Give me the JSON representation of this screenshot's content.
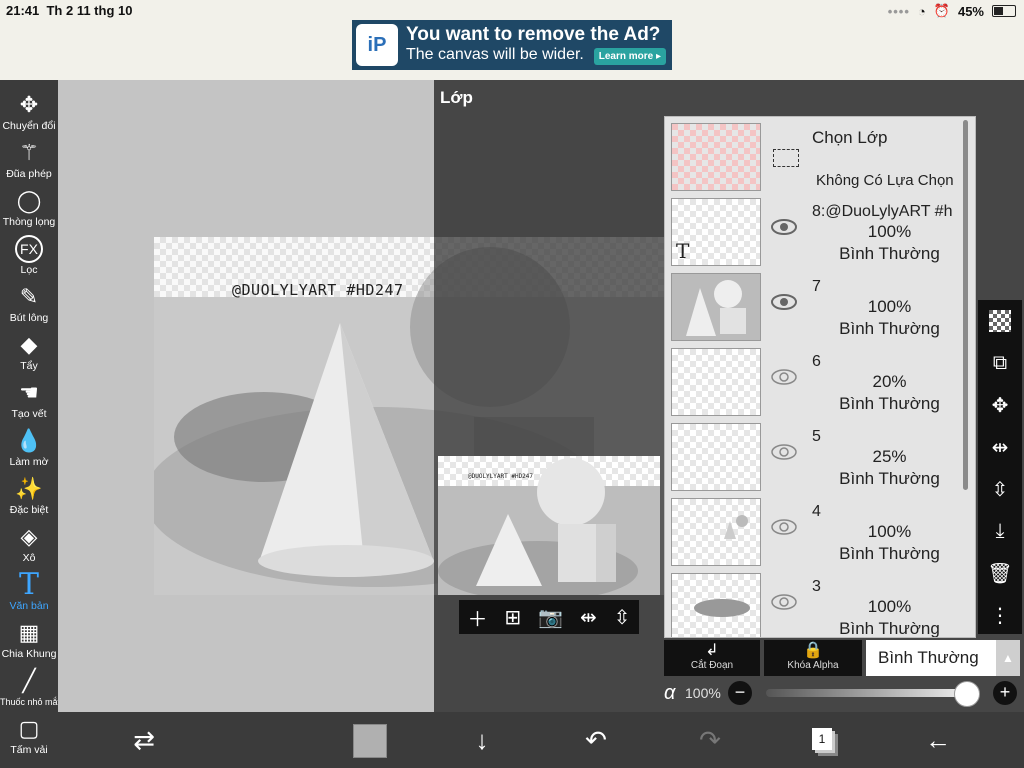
{
  "status_bar": {
    "time": "21:41",
    "date": "Th 2 11 thg 10",
    "battery": "45%"
  },
  "ad": {
    "title": "You want to remove the Ad?",
    "subtitle": "The canvas will be wider.",
    "cta": "Learn more ▸"
  },
  "toolbar": {
    "tools": [
      {
        "label": "Chuyển đổi",
        "icon": "move-icon"
      },
      {
        "label": "Đũa phép",
        "icon": "magic-wand-icon"
      },
      {
        "label": "Thòng lọng",
        "icon": "lasso-icon"
      },
      {
        "label": "Lọc",
        "icon": "fx-icon"
      },
      {
        "label": "Bút lông",
        "icon": "brush-icon"
      },
      {
        "label": "Tẩy",
        "icon": "eraser-icon"
      },
      {
        "label": "Tạo vết",
        "icon": "smudge-icon"
      },
      {
        "label": "Làm mờ",
        "icon": "blur-icon"
      },
      {
        "label": "Đặc biệt",
        "icon": "special-icon"
      },
      {
        "label": "Xô",
        "icon": "bucket-icon"
      },
      {
        "label": "Văn bản",
        "icon": "text-icon"
      },
      {
        "label": "Chia Khung",
        "icon": "frame-divider-icon"
      },
      {
        "label": "Thuốc nhỏ mắt",
        "icon": "eyedropper-icon"
      },
      {
        "label": "Tấm vải",
        "icon": "canvas-icon"
      }
    ],
    "active_tool": "Văn bản"
  },
  "canvas": {
    "watermark": "@DUOLYLYART #HD247",
    "preview_watermark": "@DUOLYLYART #HD247"
  },
  "layer_panel": {
    "title": "Lớp",
    "selection_layer": {
      "name": "Chọn Lớp",
      "status": "Không Có Lựa Chọn"
    },
    "layers": [
      {
        "name": "8:@DuoLylyART #h",
        "opacity": "100%",
        "blend": "Bình Thường",
        "visible": true,
        "is_text": true
      },
      {
        "name": "7",
        "opacity": "100%",
        "blend": "Bình Thường",
        "visible": true
      },
      {
        "name": "6",
        "opacity": "20%",
        "blend": "Bình Thường",
        "visible": false
      },
      {
        "name": "5",
        "opacity": "25%",
        "blend": "Bình Thường",
        "visible": false
      },
      {
        "name": "4",
        "opacity": "100%",
        "blend": "Bình Thường",
        "visible": false
      },
      {
        "name": "3",
        "opacity": "100%",
        "blend": "Bình Thường",
        "visible": false
      }
    ],
    "clipping_label": "Cắt Đoạn",
    "alpha_lock_label": "Khóa Alpha",
    "blend_mode": "Bình Thường",
    "alpha_symbol": "α",
    "opacity_value": "100%",
    "opacity_level": 1.0
  },
  "bottom_bar": {
    "page_count": "1"
  },
  "colors": {
    "active_tool": "#3ea6ff",
    "toolbar_bg": "#3b3b3b",
    "current_color": "#b0b0b0"
  }
}
